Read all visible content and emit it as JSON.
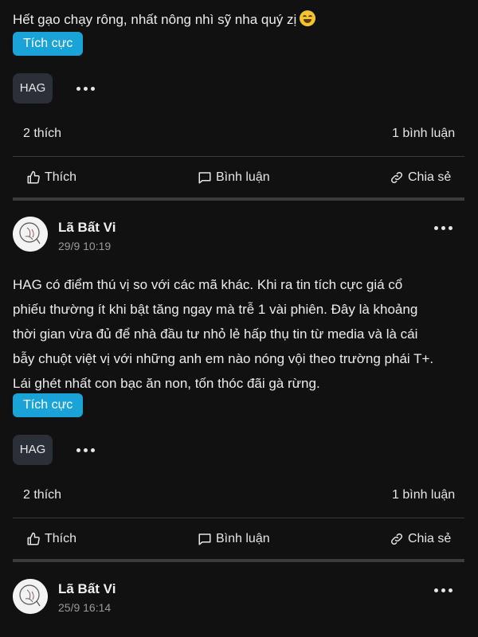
{
  "posts": [
    {
      "cut_line": "Hết gạo chạy rông, nhất nông nhì sỹ nha quý zị",
      "tag": "Tích cực",
      "ticker": "HAG",
      "likes": "2 thích",
      "comments": "1 bình luận",
      "actions": {
        "like": "Thích",
        "comment": "Bình luận",
        "share": "Chia sẻ"
      }
    },
    {
      "author": "Lã Bất Vi",
      "time": "29/9 10:19",
      "lines": [
        "HAG có điểm thú vị so với các mã khác. Khi ra tin tích cực giá cổ",
        "phiếu thường ít khi bật tăng ngay mà trễ 1 vài phiên. Đây là khoảng",
        "thời gian vừa đủ để nhà đầu tư nhỏ lẻ hấp thụ tin từ media và là cái",
        "bẫy chuột việt vị với những anh em nào nóng vội theo trường phái T+.",
        "Lái ghét nhất con bạc ăn non, tốn thóc đãi gà rừng."
      ],
      "tag": "Tích cực",
      "ticker": "HAG",
      "likes": "2 thích",
      "comments": "1 bình luận",
      "actions": {
        "like": "Thích",
        "comment": "Bình luận",
        "share": "Chia sẻ"
      }
    },
    {
      "author": "Lã Bất Vi",
      "time": "25/9 16:14"
    }
  ],
  "icons": {
    "like": "thumbs-up-icon",
    "comment": "comment-icon",
    "share": "link-icon",
    "more": "more-dots-icon",
    "emoji": "grinning-squinting-face-emoji"
  },
  "colors": {
    "background": "#111112",
    "tag": "#1aa3d6",
    "ticker_bg": "#2b2f38"
  }
}
